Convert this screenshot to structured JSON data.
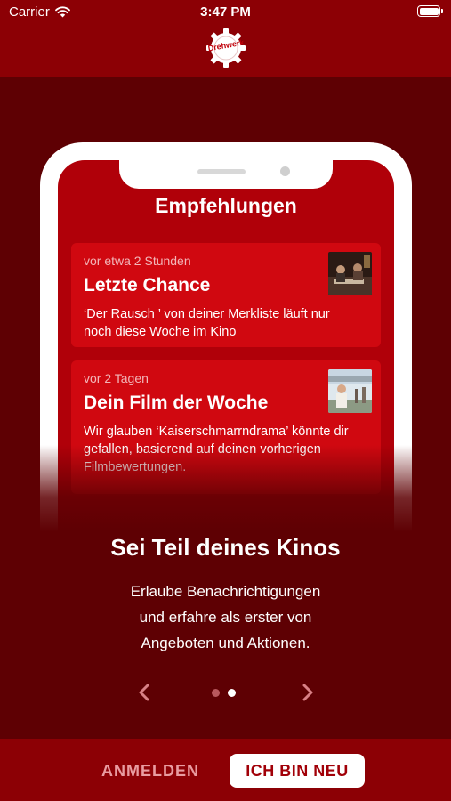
{
  "status_bar": {
    "carrier": "Carrier",
    "time": "3:47 PM"
  },
  "brand": {
    "logo_text": "Drehwerk"
  },
  "preview": {
    "title": "Empfehlungen",
    "cards": [
      {
        "meta": "vor etwa 2 Stunden",
        "title": "Letzte Chance",
        "body": "‘Der Rausch  ’ von deiner Merkliste läuft nur noch diese Woche im Kino"
      },
      {
        "meta": "vor 2 Tagen",
        "title": "Dein Film der Woche",
        "body": "Wir glauben ‘Kaiserschmarrndrama’ könnte dir gefallen, basierend auf deinen vorherigen Filmbewertungen."
      }
    ]
  },
  "onboarding": {
    "headline": "Sei Teil deines Kinos",
    "lines": [
      "Erlaube Benachrichtigungen",
      "und erfahre als erster von",
      "Angeboten und Aktionen."
    ],
    "page_index": 2,
    "page_count": 2
  },
  "footer": {
    "login_label": "ANMELDEN",
    "new_label": "ICH BIN NEU"
  },
  "colors": {
    "background": "#5e0003",
    "bar": "#8c0005",
    "card": "#d00810",
    "accent": "#a10008"
  }
}
